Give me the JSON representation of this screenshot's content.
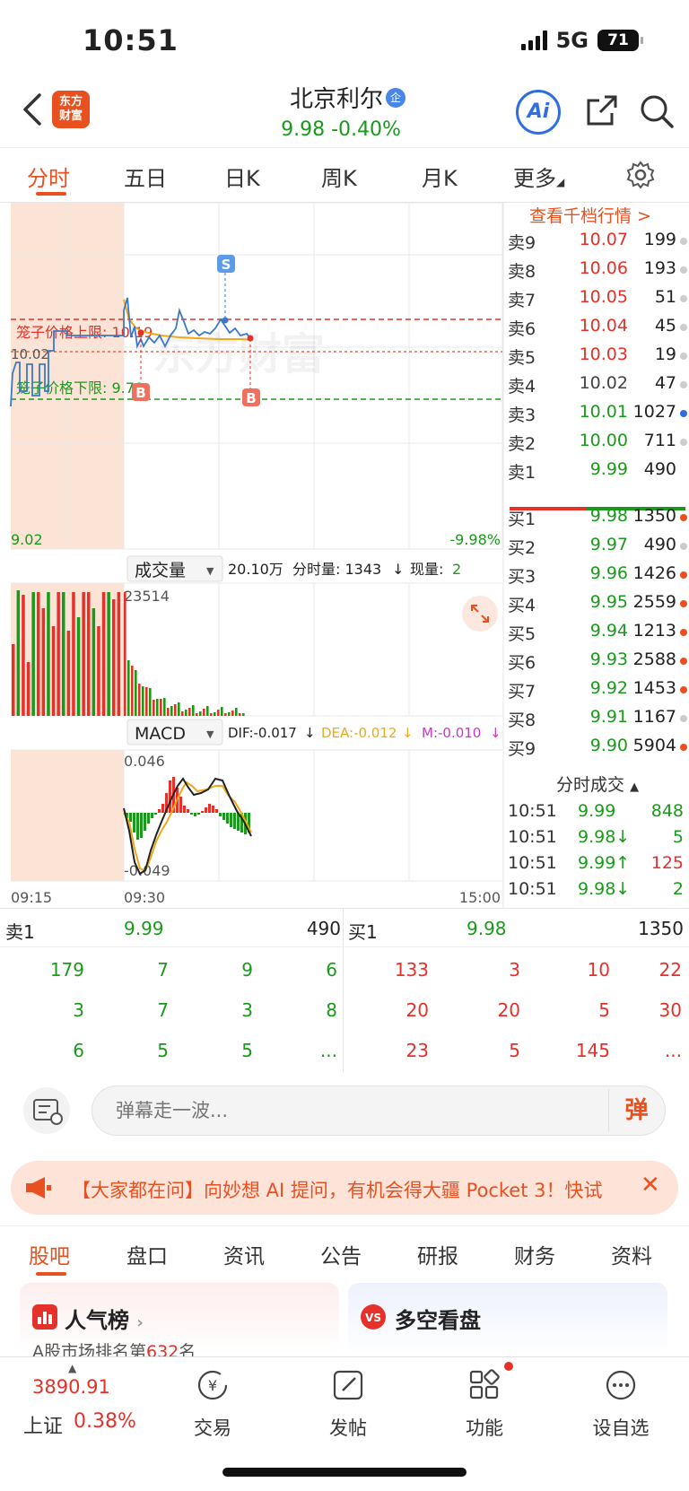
{
  "status": {
    "time": "10:51",
    "network": "5G",
    "battery": "71"
  },
  "header": {
    "logo": "东方财富",
    "name": "北京利尔",
    "badge": "企",
    "price": "9.98",
    "change": "-0.40%",
    "ai_label": "Ai"
  },
  "tabs": [
    "分时",
    "五日",
    "日K",
    "周K",
    "月K",
    "更多"
  ],
  "chart": {
    "upper_limit_label": "笼子价格上限: 10.19",
    "lower_limit_label": "笼子价格下限: 9.78",
    "price_left": "10.02",
    "low_label": "9.02",
    "low_pct": "-9.98%",
    "watermark": "东方财富",
    "marker_s": "S",
    "marker_b": "B",
    "volume_selector": "成交量",
    "volume_info_total": "20.10万",
    "volume_info_fen": "分时量: 1343",
    "volume_info_now_label": "现量:",
    "volume_info_now": "2",
    "volume_max": "23514",
    "macd_selector": "MACD",
    "dif": "DIF:-0.017",
    "dea": "DEA:-0.012",
    "m": "M:-0.010",
    "macd_max": "0.046",
    "macd_min": "-0.049",
    "time_start": "09:15",
    "time_open": "09:30",
    "time_end": "15:00",
    "colors": {
      "line": "#3a78c9",
      "avg": "#f0a818",
      "up": "#e5312a",
      "down": "#1a9a1a",
      "pre_market": "#fbe3d6"
    }
  },
  "order_book": {
    "link": "查看千档行情 >",
    "asks": [
      {
        "label": "卖9",
        "price": "10.07",
        "vol": "199",
        "color": "red",
        "dot": "#cccccc"
      },
      {
        "label": "卖8",
        "price": "10.06",
        "vol": "193",
        "color": "red",
        "dot": "#cccccc"
      },
      {
        "label": "卖7",
        "price": "10.05",
        "vol": "51",
        "color": "red",
        "dot": "#cccccc"
      },
      {
        "label": "卖6",
        "price": "10.04",
        "vol": "45",
        "color": "red",
        "dot": "#cccccc"
      },
      {
        "label": "卖5",
        "price": "10.03",
        "vol": "19",
        "color": "red",
        "dot": "#cccccc"
      },
      {
        "label": "卖4",
        "price": "10.02",
        "vol": "47",
        "color": "gray",
        "dot": "#cccccc"
      },
      {
        "label": "卖3",
        "price": "10.01",
        "vol": "1027",
        "color": "green",
        "dot": "#2f6ee0"
      },
      {
        "label": "卖2",
        "price": "10.00",
        "vol": "711",
        "color": "green",
        "dot": "#cccccc"
      },
      {
        "label": "卖1",
        "price": "9.99",
        "vol": "490",
        "color": "green",
        "dot": ""
      }
    ],
    "bids": [
      {
        "label": "买1",
        "price": "9.98",
        "vol": "1350",
        "color": "green",
        "dot": "#e8501f"
      },
      {
        "label": "买2",
        "price": "9.97",
        "vol": "490",
        "color": "green",
        "dot": "#cccccc"
      },
      {
        "label": "买3",
        "price": "9.96",
        "vol": "1426",
        "color": "green",
        "dot": "#e8501f"
      },
      {
        "label": "买4",
        "price": "9.95",
        "vol": "2559",
        "color": "green",
        "dot": "#e8501f"
      },
      {
        "label": "买5",
        "price": "9.94",
        "vol": "1213",
        "color": "green",
        "dot": "#e8501f"
      },
      {
        "label": "买6",
        "price": "9.93",
        "vol": "2588",
        "color": "green",
        "dot": "#e8501f"
      },
      {
        "label": "买7",
        "price": "9.92",
        "vol": "1453",
        "color": "green",
        "dot": "#e8501f"
      },
      {
        "label": "买8",
        "price": "9.91",
        "vol": "1167",
        "color": "green",
        "dot": "#cccccc"
      },
      {
        "label": "买9",
        "price": "9.90",
        "vol": "5904",
        "color": "green",
        "dot": "#e8501f"
      }
    ]
  },
  "trades": {
    "title": "分时成交",
    "rows": [
      {
        "time": "10:51",
        "price": "9.99",
        "vol": "848",
        "color": "green",
        "vcolor": "green"
      },
      {
        "time": "10:51",
        "price": "9.98↓",
        "vol": "5",
        "color": "green",
        "vcolor": "green"
      },
      {
        "time": "10:51",
        "price": "9.99↑",
        "vol": "125",
        "color": "green",
        "vcolor": "red"
      },
      {
        "time": "10:51",
        "price": "9.98↓",
        "vol": "2",
        "color": "green",
        "vcolor": "green"
      }
    ]
  },
  "summary": {
    "sell_label": "卖1",
    "sell_price": "9.99",
    "sell_vol": "490",
    "buy_label": "买1",
    "buy_price": "9.98",
    "buy_vol": "1350",
    "sell_grid": [
      [
        "179",
        "7",
        "9",
        "6"
      ],
      [
        "3",
        "7",
        "3",
        "8"
      ],
      [
        "6",
        "5",
        "5",
        "..."
      ]
    ],
    "buy_grid": [
      [
        "133",
        "3",
        "10",
        "22"
      ],
      [
        "20",
        "20",
        "5",
        "30"
      ],
      [
        "23",
        "5",
        "145",
        "..."
      ]
    ]
  },
  "danmu": {
    "placeholder": "弹幕走一波...",
    "send": "弹"
  },
  "banner": {
    "text": "【大家都在问】向妙想 AI 提问，有机会得大疆 Pocket 3！快试"
  },
  "sub_tabs": [
    "股吧",
    "盘口",
    "资讯",
    "公告",
    "研报",
    "财务",
    "资料"
  ],
  "cards": {
    "left_title": "人气榜",
    "left_sub_prefix": "A股市场排名第",
    "left_rank": "632",
    "left_sub_suffix": "名",
    "right_title": "多空看盘"
  },
  "bottom_nav": {
    "index_value": "3890.91",
    "index_name": "上证",
    "index_change": "0.38%",
    "items": [
      "交易",
      "发帖",
      "功能",
      "设自选"
    ]
  }
}
